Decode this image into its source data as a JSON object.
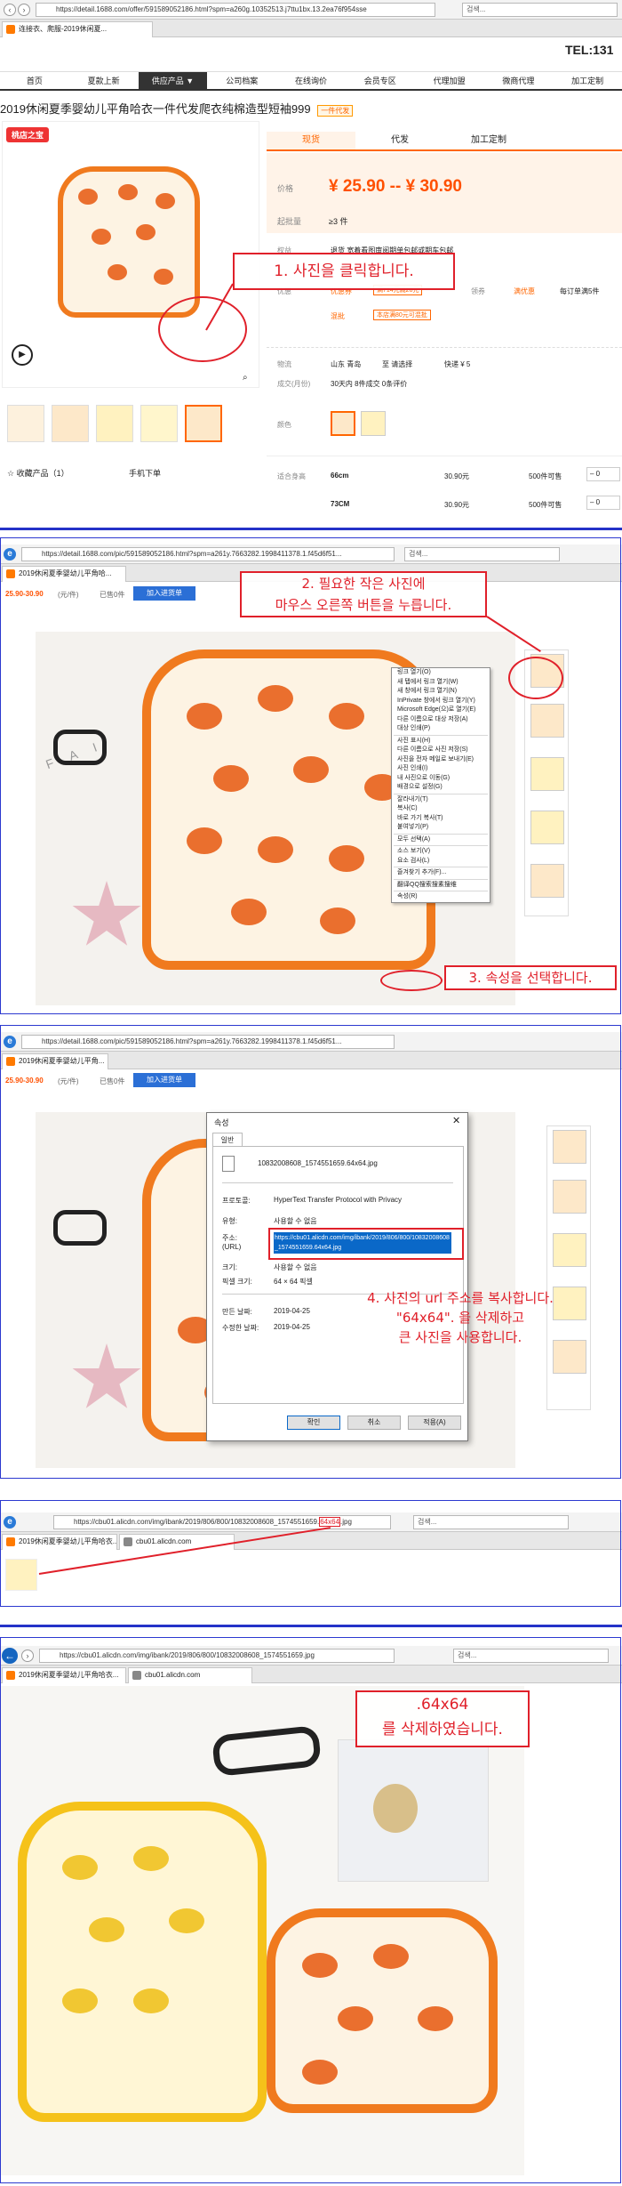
{
  "panel1": {
    "url": "https://detail.1688.com/offer/591589052186.html?spm=a260g.10352513.j7ttu1bx.13.2ea76f954sse",
    "search": "검색...",
    "tab_prefix": "连接衣、爬服-2019休闲夏...",
    "tel": "TEL:131",
    "nav": [
      "首页",
      "夏款上新",
      "供应产品 ▼",
      "公司档案",
      "在线询价",
      "会员专区",
      "代理加盟",
      "微商代理",
      "加工定制"
    ],
    "product_title": "2019休闲夏季婴幼儿平角哈衣一件代发爬衣纯棉造型短袖999",
    "product_badge": "一件代发",
    "tabs": [
      "现货",
      "代发",
      "加工定制"
    ],
    "price_label": "价格",
    "price": "¥ 25.90 -- ¥ 30.90",
    "moq_label": "起批量",
    "moq": "≥3 件",
    "service_label": "权益",
    "service_text": "退货 宽着看图审阅期单包邮或期车包邮",
    "promo_label": "优惠",
    "promo_coupon": "优惠券",
    "promo_coupon_text": "满714元减20元",
    "promo2_label": "混批",
    "promo2_text": "本店满80元可混批",
    "promo3_label": "领券",
    "promo3_text": "满优惠",
    "promo4_label": "每订单满5件",
    "logistics_label": "物流",
    "logistics_from": "山东 青岛",
    "logistics_to": "至 请选择",
    "logistics_fee": "快递 ¥ 5",
    "sales_label": "成交(月份)",
    "sales": "30天内 8件成交  0条评价",
    "color_label": "颜色",
    "size_label": "适合身高",
    "sizes": [
      {
        "size": "66cm",
        "price": "30.90元",
        "stock": "500件可售"
      },
      {
        "size": "73CM",
        "price": "30.90元",
        "stock": "500件可售"
      }
    ],
    "logo": "桃店之宝",
    "favorite": "☆ 收藏产品（1）",
    "mobile_order": "手机下单",
    "callout": "1. 사진을 클릭합니다."
  },
  "panel2": {
    "url": "https://detail.1688.com/pic/591589052186.html?spm=a261y.7663282.1998411378.1.f45d6f51...",
    "search": "검색...",
    "tab_label": "2019休闲夏季婴幼儿平角哈...",
    "price": "25.90-30.90",
    "price_unit": "(元/件)",
    "sold": "已售0件",
    "cart_button": "加入进货单",
    "callout2": "2. 필요한 작은 사진에\n마우스 오른쪽 버튼을 누릅니다.",
    "callout3": "3. 속성을 선택합니다.",
    "menu": [
      "링크 열기(O)",
      "새 탭에서 링크 열기(W)",
      "새 창에서 링크 열기(N)",
      "InPrivate 창에서 링크 열기(Y)",
      "Microsoft Edge(으)로 열기(E)",
      "다른 이름으로 대상 저장(A)",
      "대상 인쇄(P)",
      "-",
      "사진 표시(H)",
      "다른 이름으로 사진 저장(S)",
      "사진을 전자 메일로 보내기(E)",
      "사진 인쇄(I)",
      "내 사진으로 이동(G)",
      "배경으로 설정(G)",
      "-",
      "잘라내기(T)",
      "복사(C)",
      "바로 가기 복사(T)",
      "붙여넣기(P)",
      "-",
      "모두 선택(A)",
      "-",
      "소스 보기(V)",
      "요소 검사(L)",
      "-",
      "즐겨찾기 추가(F)...",
      "-",
      "翻译QQ搜索搜素搜维",
      "-",
      "속성(R)"
    ]
  },
  "panel3": {
    "url": "https://detail.1688.com/pic/591589052186.html?spm=a261y.7663282.1998411378.1.f45d6f51...",
    "tab_label": "2019休闲夏季婴幼儿平角...",
    "price": "25.90-30.90",
    "price_unit": "(元/件)",
    "sold": "已售0件",
    "cart_button": "加入进货单",
    "dialog_title": "속성",
    "dialog_tab": "일반",
    "file_name": "10832008608_1574551659.64x64.jpg",
    "protocol_label": "프로토콜:",
    "protocol": "HyperText Transfer Protocol with Privacy",
    "type_label": "유형:",
    "type": "사용할 수 없음",
    "address_label": "주소:\n(URL)",
    "address": "https://cbu01.alicdn.com/img/ibank/2019/806/800/10832008608_1574551659.64x64.jpg",
    "size_label": "크기:",
    "size": "사용할 수 없음",
    "dim_label": "픽셀 크기:",
    "dim": "64 × 64 픽셀",
    "created_label": "만든 날짜:",
    "created": "2019-04-25",
    "modified_label": "수정한 날짜:",
    "modified": "2019-04-25",
    "ok": "확인",
    "cancel": "취소",
    "apply": "적용(A)",
    "callout": "4. 사진의 url 주소를 복사합니다.\n\"64x64\". 을 삭제하고\n큰 사진을 사용합니다."
  },
  "panel4": {
    "url": "https://cbu01.alicdn.com/img/ibank/2019/806/800/10832008608_1574551659.",
    "url_highlight": "64x64",
    "url_suffix": ".jpg",
    "search": "검색...",
    "tab1": "2019休闲夏季婴幼儿平角哈衣...",
    "tab2": "cbu01.alicdn.com"
  },
  "panel5": {
    "url": "https://cbu01.alicdn.com/img/ibank/2019/806/800/10832008608_1574551659.jpg",
    "search": "검색...",
    "tab1": "2019休闲夏季婴幼儿平角哈衣...",
    "tab2": "cbu01.alicdn.com",
    "callout": ".64x64\n를 삭제하였습니다."
  },
  "colors": {
    "accent_red": "#e0202a",
    "price_orange": "#ff5000",
    "separator_blue": "#2432c8",
    "romper_orange": "#f07a1e",
    "romper_yellow": "#f5c21a"
  }
}
